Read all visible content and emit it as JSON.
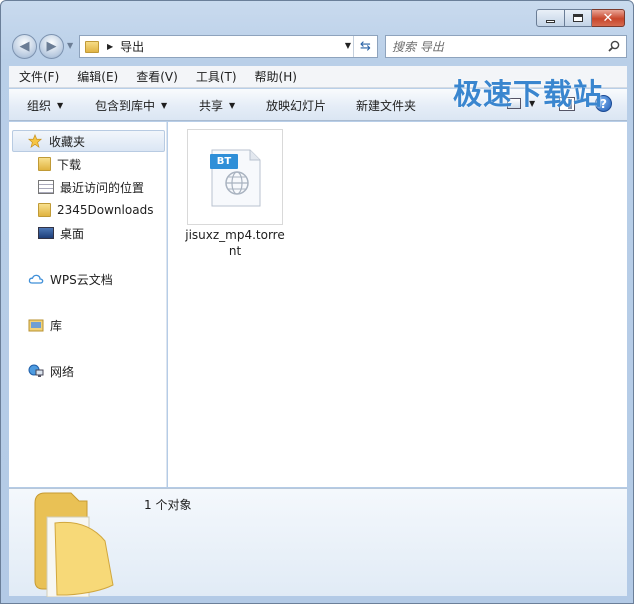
{
  "window": {
    "address": {
      "path_segment": "导出"
    },
    "search": {
      "placeholder": "搜索 导出"
    }
  },
  "menu": [
    {
      "label": "文件(F)"
    },
    {
      "label": "编辑(E)"
    },
    {
      "label": "查看(V)"
    },
    {
      "label": "工具(T)"
    },
    {
      "label": "帮助(H)"
    }
  ],
  "toolbar": {
    "organize": "组织",
    "include_library": "包含到库中",
    "share": "共享",
    "slideshow": "放映幻灯片",
    "new_folder": "新建文件夹"
  },
  "nav": {
    "favorites": "收藏夹",
    "downloads": "下载",
    "recent": "最近访问的位置",
    "downloads2345": "2345Downloads",
    "desktop": "桌面",
    "wps_cloud": "WPS云文档",
    "libraries": "库",
    "network": "网络"
  },
  "files": [
    {
      "name": "jisuxz_mp4.torrent",
      "badge": "BT"
    }
  ],
  "details": {
    "item_count": "1 个对象"
  },
  "watermark": "极速下载站",
  "colors": {
    "accent": "#3a86cf",
    "bt_badge": "#2f8fd8"
  }
}
